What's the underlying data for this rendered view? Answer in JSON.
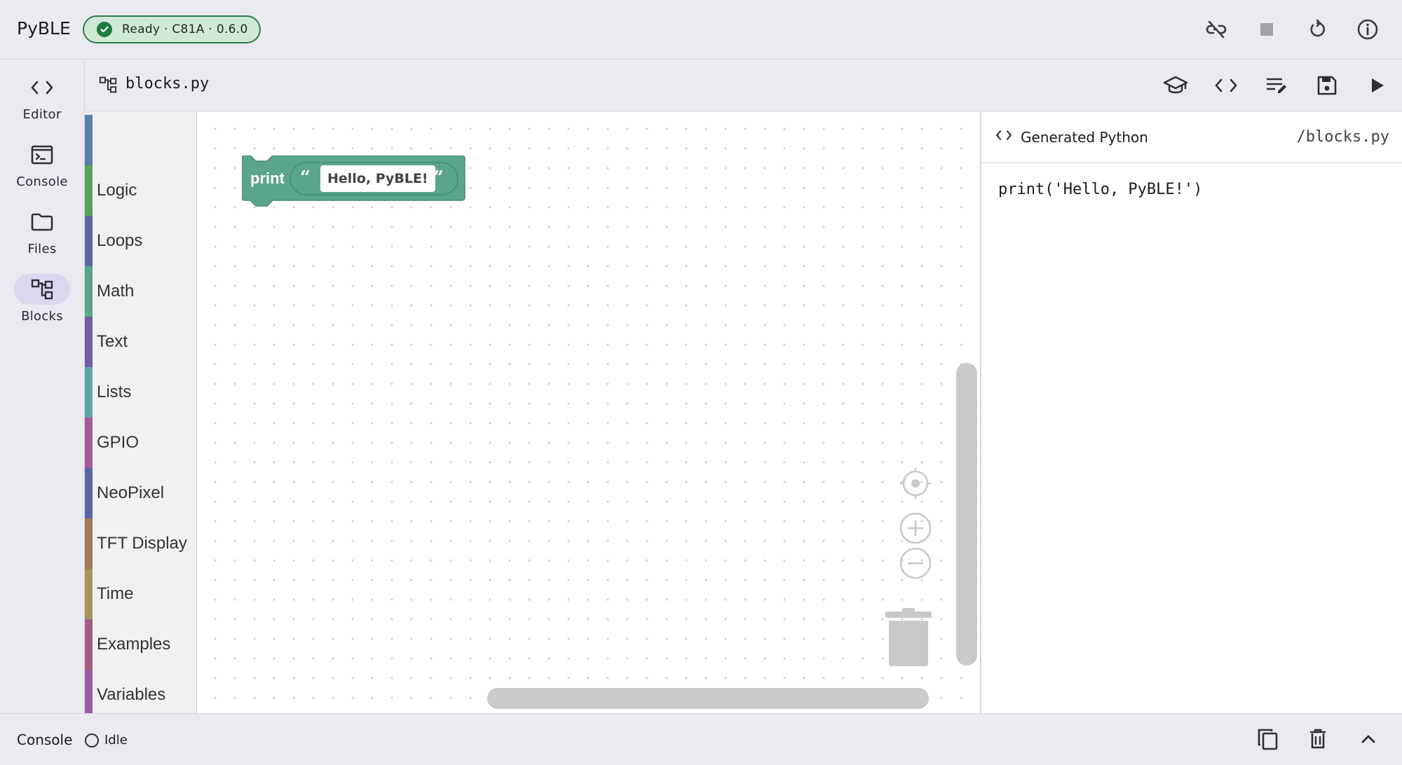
{
  "app": {
    "title": "PyBLE",
    "status": "Ready · C81A · 0.6.0",
    "status_color": "#2e7d4a"
  },
  "top_actions": [
    {
      "icon": "link-off-icon"
    },
    {
      "icon": "stop-icon"
    },
    {
      "icon": "restart-icon"
    },
    {
      "icon": "info-icon"
    }
  ],
  "nav": {
    "items": [
      {
        "label": "Editor",
        "icon": "code-icon"
      },
      {
        "label": "Console",
        "icon": "terminal-icon"
      },
      {
        "label": "Files",
        "icon": "folder-icon"
      },
      {
        "label": "Blocks",
        "icon": "blocks-icon",
        "active": true
      }
    ]
  },
  "filebar": {
    "filename": "blocks.py",
    "actions": [
      {
        "icon": "tutorial-icon"
      },
      {
        "icon": "code-toggle-icon"
      },
      {
        "icon": "format-icon"
      },
      {
        "icon": "save-icon"
      },
      {
        "icon": "run-icon"
      }
    ]
  },
  "toolbox": {
    "categories": [
      {
        "label": "Logic",
        "color": "#5b80a5"
      },
      {
        "label": "Loops",
        "color": "#5ba55b"
      },
      {
        "label": "Math",
        "color": "#5b67a5"
      },
      {
        "label": "Text",
        "color": "#5ba58c"
      },
      {
        "label": "Lists",
        "color": "#745ba5"
      },
      {
        "label": "GPIO",
        "color": "#5ba5a5"
      },
      {
        "label": "NeoPixel",
        "color": "#a55b99"
      },
      {
        "label": "TFT Display",
        "color": "#5b67a5"
      },
      {
        "label": "Time",
        "color": "#a5745b"
      },
      {
        "label": "Examples",
        "color": "#a5945b"
      },
      {
        "label": "Variables",
        "color": "#a55b80"
      }
    ],
    "last_color": "#995ba5"
  },
  "workspace": {
    "block": {
      "keyword": "print",
      "open_quote": "“",
      "text": "Hello, PyBLE!",
      "close_quote": "”",
      "color": "#5ba58c"
    }
  },
  "code_panel": {
    "title": "Generated Python",
    "path": "/blocks.py",
    "code": "print('Hello, PyBLE!')"
  },
  "console_bar": {
    "label": "Console",
    "status": "Idle",
    "actions": [
      {
        "icon": "copy-icon"
      },
      {
        "icon": "delete-icon"
      },
      {
        "icon": "expand-icon"
      }
    ]
  }
}
